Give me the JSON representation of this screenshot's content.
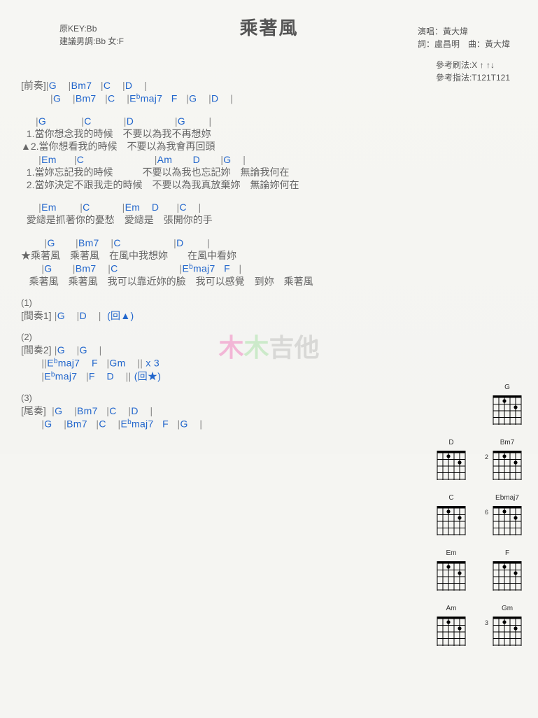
{
  "title": "乘著風",
  "meta": {
    "key_label": "原KEY:Bb",
    "suggest_label": "建議男調:Bb 女:F",
    "singer_label": "演唱：黃大煒",
    "credit_label": "詞：盧昌明　曲：黃大煒",
    "strum_label": "參考刷法:X ↑ ↑↓",
    "finger_label": "參考指法:T121T121"
  },
  "intro": {
    "label": "[前奏]",
    "line1": "|G    |Bm7   |C    |D    |",
    "line2": "|G    |Bm7   |C    |E♭maj7   F   |G    |D    |"
  },
  "verse": {
    "chords1": "     |G            |C           |D              |G        |",
    "lyric1a": "  1.當你想念我的時候　不要以為我不再想妳",
    "lyric1b": "▲2.當你想看我的時候　不要以為我會再回頭",
    "chords2": "      |Em      |C                        |Am       D       |G    |",
    "lyric2a": "  1.當妳忘記我的時候　　　不要以為我也忘記妳　無論我何在",
    "lyric2b": "  2.當妳決定不跟我走的時候　不要以為我真放棄妳　無論妳何在"
  },
  "pre": {
    "chords": "      |Em        |C           |Em    D      |C    |",
    "lyric": "  愛總是抓著你的憂愁　愛總是　張開你的手"
  },
  "chorus": {
    "chords1": "        |G       |Bm7    |C                  |D        |",
    "lyric1": "★乘著風　乘著風　在風中我想妳　　在風中看妳",
    "chords2": "       |G       |Bm7    |C                     |E♭maj7   F   |",
    "lyric2": "   乘著風　乘著風　我可以靠近妳的臉　我可以感覺　到妳　乘著風"
  },
  "sections": {
    "s1_num": "(1)",
    "s1_label": "[間奏1]",
    "s1_line": " |G    |D    |  (回▲)",
    "s2_num": "(2)",
    "s2_label": "[間奏2]",
    "s2_line1": " |G    |G    |",
    "s2_line2": "       ||E♭maj7    F   |Gm    || x 3",
    "s2_line3": "       |E♭maj7   |F    D    || (回★)",
    "s3_num": "(3)",
    "s3_label": "[尾奏]",
    "s3_line1": "  |G    |Bm7   |C    |D    |",
    "s3_line2": "       |G    |Bm7   |C    |E♭maj7   F   |G    |"
  },
  "chord_diagrams": [
    [
      {
        "name": "G",
        "fret": ""
      }
    ],
    [
      {
        "name": "D",
        "fret": ""
      },
      {
        "name": "Bm7",
        "fret": "2"
      }
    ],
    [
      {
        "name": "C",
        "fret": ""
      },
      {
        "name": "Ebmaj7",
        "fret": "6"
      }
    ],
    [
      {
        "name": "Em",
        "fret": ""
      },
      {
        "name": "F",
        "fret": ""
      }
    ],
    [
      {
        "name": "Am",
        "fret": ""
      },
      {
        "name": "Gm",
        "fret": "3"
      }
    ]
  ],
  "watermark": {
    "a": "木",
    "b": "木",
    "c": "吉他"
  }
}
